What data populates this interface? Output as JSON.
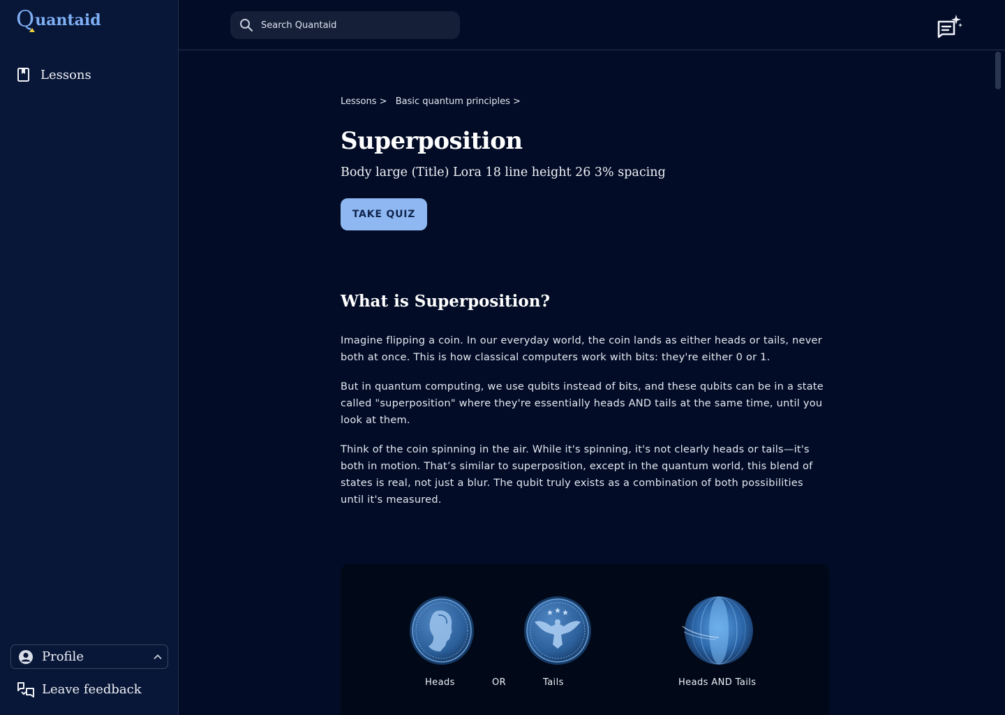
{
  "app": {
    "logo_letter": "Q",
    "logo_rest": "uantaid"
  },
  "sidebar": {
    "nav": [
      {
        "label": "Lessons",
        "icon": "book-icon"
      }
    ],
    "profile": {
      "label": "Profile",
      "icon": "user-circle-icon",
      "toggle_icon": "chevron-up-icon"
    },
    "feedback": {
      "label": "Leave feedback",
      "icon": "feedback-icon"
    }
  },
  "header": {
    "search": {
      "placeholder": "Search Quantaid",
      "value": ""
    },
    "ai_chat_icon": "ai-chat-sparkle-icon"
  },
  "breadcrumb": {
    "items": [
      "Lessons >",
      "Basic quantum principles >"
    ]
  },
  "lesson": {
    "title": "Superposition",
    "subtitle": "Body large (Title) Lora 18 line height 26 3% spacing",
    "quiz_button": "TAKE QUIZ",
    "section_heading": "What is Superposition?",
    "paragraphs": [
      "Imagine flipping a coin. In our everyday world, the coin lands as either heads or tails, never both at once. This is how classical computers work with bits: they're either 0 or 1.",
      "But in quantum computing, we use qubits instead of bits, and these qubits can be in a state called \"superposition\" where they're essentially heads AND tails at the same time, until you look at them.",
      "Think of the coin spinning in the air. While it's spinning, it's not clearly heads or tails—it's both in motion. That’s similar to superposition, except in the quantum world, this blend of states is real, not just a blur. The qubit truly exists as a combination of both possibilities until it's measured."
    ]
  },
  "illustration": {
    "heads_label": "Heads",
    "or_label": "OR",
    "tails_label": "Tails",
    "both_label": "Heads AND Tails"
  },
  "colors": {
    "background": "#020c26",
    "sidebar": "#081637",
    "accent": "#8fb8f3",
    "logo": "#7fb0f5",
    "logo_dot": "#f2d13b"
  }
}
